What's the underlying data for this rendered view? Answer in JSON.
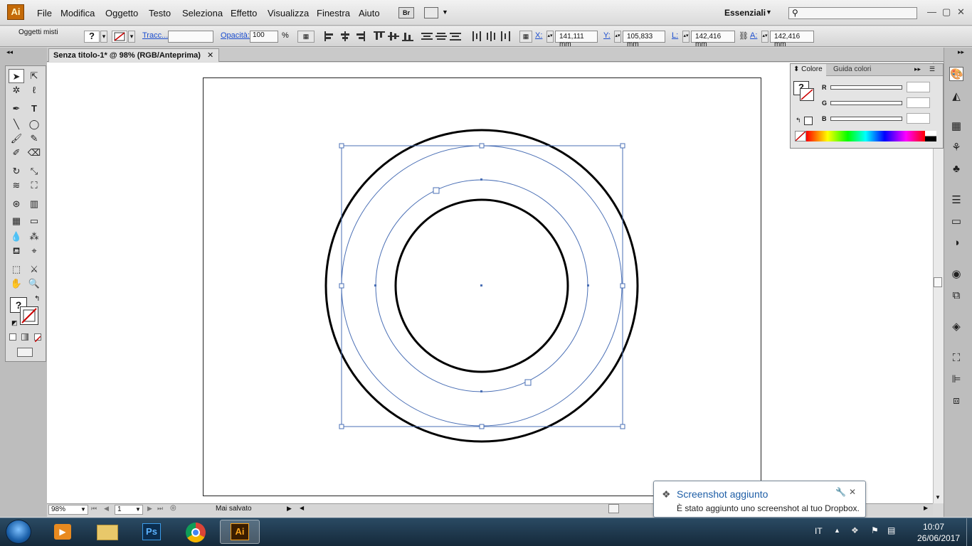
{
  "app": {
    "logo": "Ai",
    "workspace": "Essenziali"
  },
  "menu": [
    "File",
    "Modifica",
    "Oggetto",
    "Testo",
    "Seleziona",
    "Effetto",
    "Visualizza",
    "Finestra",
    "Aiuto"
  ],
  "toolbar": {
    "bridge": "Br",
    "selection_label": "Oggetti misti",
    "fill_glyph": "?",
    "stroke_label": "Tracc...",
    "opacity_label": "Opacità:",
    "opacity_value": "100",
    "opacity_unit": "%",
    "x_label": "X:",
    "x_value": "141,111 mm",
    "y_label": "Y:",
    "y_value": "105,833 mm",
    "w_label": "L:",
    "w_value": "142,416 mm",
    "h_label": "A:",
    "h_value": "142,416 mm"
  },
  "document": {
    "tab_title": "Senza titolo-1* @ 98% (RGB/Anteprima)",
    "tab_close": "✕"
  },
  "status": {
    "zoom": "98%",
    "page": "1",
    "save_state": "Mai salvato"
  },
  "color_panel": {
    "tabs": [
      "Colore",
      "Guida colori"
    ],
    "fill_glyph": "?",
    "channels": [
      {
        "name": "R",
        "value": ""
      },
      {
        "name": "G",
        "value": ""
      },
      {
        "name": "B",
        "value": ""
      }
    ]
  },
  "taskbar": {
    "lang": "IT",
    "time": "10:07",
    "date": "26/06/2017"
  },
  "notification": {
    "title": "Screenshot aggiunto",
    "message": "È stato aggiunto uno screenshot al tuo Dropbox."
  },
  "colors": {
    "selection": "#4a6fb5",
    "accent_ai": "#c46a08"
  }
}
